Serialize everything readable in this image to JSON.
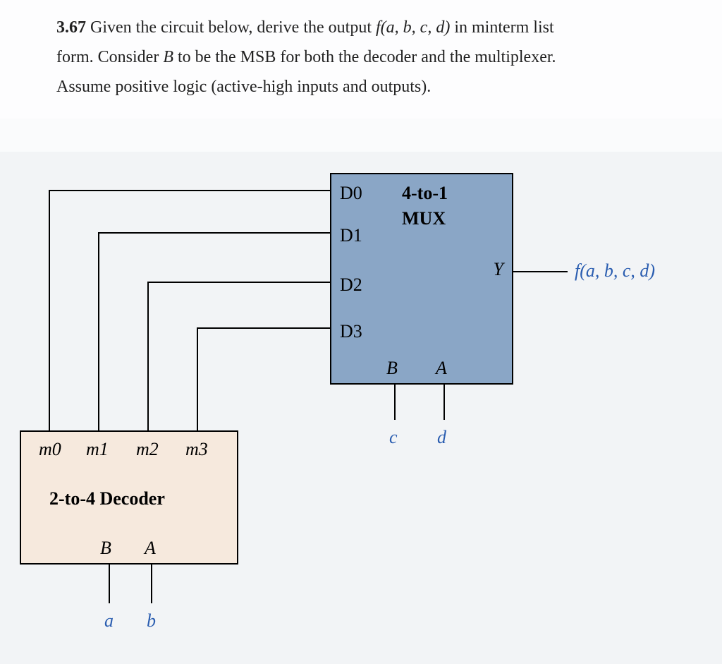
{
  "problem": {
    "number": "3.67",
    "line1_a": "Given the circuit below, derive the output ",
    "line1_func": "f(a, b, c, d)",
    "line1_b": " in minterm list",
    "line2_a": "form. Consider ",
    "line2_B": "B",
    "line2_b": " to be the MSB for both the decoder and the multiplexer.",
    "line3": "Assume positive logic (active-high inputs and outputs)."
  },
  "mux": {
    "title1": "4-to-1",
    "title2": "MUX",
    "d0": "D0",
    "d1": "D1",
    "d2": "D2",
    "d3": "D3",
    "y": "Y",
    "selB": "B",
    "selA": "A"
  },
  "decoder": {
    "m0": "m0",
    "m1": "m1",
    "m2": "m2",
    "m3": "m3",
    "title": "2-to-4 Decoder",
    "selB": "B",
    "selA": "A"
  },
  "signals": {
    "out": "f(a, b, c, d)",
    "c": "c",
    "d": "d",
    "a": "a",
    "b": "b"
  }
}
